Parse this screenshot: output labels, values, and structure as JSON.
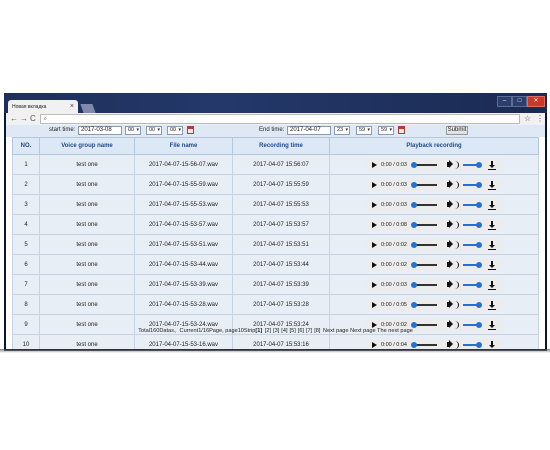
{
  "browser": {
    "tab_title": "Новая вкладка",
    "tab_close": "×",
    "address_value": "",
    "back": "←",
    "forward": "→",
    "reload": "C",
    "search_glyph": "🔍",
    "star": "☆",
    "menu": "⋮",
    "min": "–",
    "max": "□",
    "close": "✕"
  },
  "filter": {
    "start_label": "start time:",
    "start_date": "2017-03-08",
    "start_hour": "00",
    "start_min": "00",
    "start_sec": "00",
    "end_label": "End time:",
    "end_date": "2017-04-07",
    "end_hour": "23",
    "end_min": "59",
    "end_sec": "59",
    "submit": "Submit"
  },
  "table": {
    "headers": [
      "NO.",
      "Voice group name",
      "File name",
      "Recording time",
      "Playback recording"
    ],
    "rows": [
      {
        "no": "1",
        "group": "test one",
        "file": "2017-04-07-15-56-07.wav",
        "time": "2017-04-07 15:56:07",
        "play": "0:00 / 0:03"
      },
      {
        "no": "2",
        "group": "test one",
        "file": "2017-04-07-15-55-59.wav",
        "time": "2017-04-07 15:55:59",
        "play": "0:00 / 0:03"
      },
      {
        "no": "3",
        "group": "test one",
        "file": "2017-04-07-15-55-53.wav",
        "time": "2017-04-07 15:55:53",
        "play": "0:00 / 0:03"
      },
      {
        "no": "4",
        "group": "test one",
        "file": "2017-04-07-15-53-57.wav",
        "time": "2017-04-07 15:53:57",
        "play": "0:00 / 0:08"
      },
      {
        "no": "5",
        "group": "test one",
        "file": "2017-04-07-15-53-51.wav",
        "time": "2017-04-07 15:53:51",
        "play": "0:00 / 0:02"
      },
      {
        "no": "6",
        "group": "test one",
        "file": "2017-04-07-15-53-44.wav",
        "time": "2017-04-07 15:53:44",
        "play": "0:00 / 0:02"
      },
      {
        "no": "7",
        "group": "test one",
        "file": "2017-04-07-15-53-39.wav",
        "time": "2017-04-07 15:53:39",
        "play": "0:00 / 0:03"
      },
      {
        "no": "8",
        "group": "test one",
        "file": "2017-04-07-15-53-28.wav",
        "time": "2017-04-07 15:53:28",
        "play": "0:00 / 0:05"
      },
      {
        "no": "9",
        "group": "test one",
        "file": "2017-04-07-15-53-24.wav",
        "time": "2017-04-07 15:53:24",
        "play": "0:00 / 0:02"
      },
      {
        "no": "10",
        "group": "test one",
        "file": "2017-04-07-15-53-16.wav",
        "time": "2017-04-07 15:53:16",
        "play": "0:00 / 0:04"
      }
    ]
  },
  "pager": {
    "summary": "Total160Datas、Current1/16Page, page10Strip",
    "current": "[1]",
    "pages": [
      "[2]",
      "[3]",
      "[4]",
      "[5]",
      "[6]",
      "[7]",
      "[8]"
    ],
    "next_page": "Next page",
    "next_page_2": "Next page",
    "the_next_page": "The next page"
  }
}
